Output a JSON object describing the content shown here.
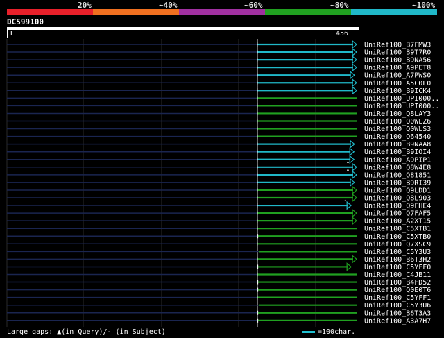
{
  "identity_legend": {
    "labels": [
      "20%",
      "~40%",
      "~60%",
      "~80%",
      "~100%"
    ],
    "colors": [
      "#e8202a",
      "#f07020",
      "#a030a0",
      "#20a020",
      "#20b8c8"
    ]
  },
  "query": {
    "name": "DC599100",
    "start": "1",
    "end": "456"
  },
  "hits": [
    {
      "name": "UniRef100_B7FMW3",
      "color": "#20b8c8",
      "start": 0,
      "end": 456,
      "arrow": true
    },
    {
      "name": "UniRef100_B9T7R0",
      "color": "#20b8c8",
      "start": 0,
      "end": 456,
      "arrow": true
    },
    {
      "name": "UniRef100_B9NA56",
      "color": "#20b8c8",
      "start": 0,
      "end": 456,
      "arrow": true
    },
    {
      "name": "UniRef100_A9PET8",
      "color": "#20b8c8",
      "start": 0,
      "end": 456,
      "arrow": true
    },
    {
      "name": "UniRef100_A7PWS0",
      "color": "#20b8c8",
      "start": 0,
      "end": 446,
      "arrow": true
    },
    {
      "name": "UniRef100_A5C0L0",
      "color": "#20b8c8",
      "start": 0,
      "end": 456,
      "arrow": true
    },
    {
      "name": "UniRef100_B9ICK4",
      "color": "#20b8c8",
      "start": 0,
      "end": 456,
      "arrow": true
    },
    {
      "name": "UniRef100_UPI000..",
      "color": "#20a020",
      "start": 0,
      "end": 456,
      "arrow": false
    },
    {
      "name": "UniRef100_UPI000..",
      "color": "#20a020",
      "start": 0,
      "end": 456,
      "arrow": false
    },
    {
      "name": "UniRef100_Q8LAY3",
      "color": "#20a020",
      "start": 0,
      "end": 456,
      "arrow": false
    },
    {
      "name": "UniRef100_Q0WLZ6",
      "color": "#20a020",
      "start": 0,
      "end": 456,
      "arrow": false
    },
    {
      "name": "UniRef100_Q0WLS3",
      "color": "#20a020",
      "start": 0,
      "end": 456,
      "arrow": false
    },
    {
      "name": "UniRef100_O64540",
      "color": "#20a020",
      "start": 0,
      "end": 456,
      "arrow": false
    },
    {
      "name": "UniRef100_B9NAA8",
      "color": "#20b8c8",
      "start": 0,
      "end": 446,
      "arrow": true
    },
    {
      "name": "UniRef100_B9IOI4",
      "color": "#20b8c8",
      "start": 0,
      "end": 444,
      "arrow": true
    },
    {
      "name": "UniRef100_A9PIP1",
      "color": "#20b8c8",
      "start": 0,
      "end": 444,
      "arrow": true
    },
    {
      "name": "UniRef100_Q8W4E8",
      "color": "#20b8c8",
      "start": 0,
      "end": 456,
      "arrow": true,
      "gap": 416
    },
    {
      "name": "UniRef100_O81851",
      "color": "#20b8c8",
      "start": 0,
      "end": 456,
      "arrow": true,
      "gap": 416
    },
    {
      "name": "UniRef100_B9RI39",
      "color": "#20b8c8",
      "start": 0,
      "end": 446,
      "arrow": true
    },
    {
      "name": "UniRef100_Q9LDD1",
      "color": "#20a020",
      "start": 0,
      "end": 456,
      "arrow": true
    },
    {
      "name": "UniRef100_Q8L903",
      "color": "#20a020",
      "start": 0,
      "end": 456,
      "arrow": true
    },
    {
      "name": "UniRef100_Q9FHE4",
      "color": "#20b8c8",
      "start": 0,
      "end": 431,
      "arrow": true,
      "gap": 404
    },
    {
      "name": "UniRef100_Q7FAF5",
      "color": "#20a020",
      "start": 0,
      "end": 456,
      "arrow": true
    },
    {
      "name": "UniRef100_A2XT15",
      "color": "#20a020",
      "start": 0,
      "end": 456,
      "arrow": true
    },
    {
      "name": "UniRef100_C5XTB1",
      "color": "#20a020",
      "start": 0,
      "end": 456,
      "arrow": false
    },
    {
      "name": "UniRef100_C5XTB0",
      "color": "#20a020",
      "start": 2,
      "end": 456,
      "arrow": false
    },
    {
      "name": "UniRef100_Q7XSC9",
      "color": "#20a020",
      "start": 0,
      "end": 456,
      "arrow": false
    },
    {
      "name": "UniRef100_C5Y3U3",
      "color": "#20a020",
      "start": 8,
      "end": 456,
      "arrow": false
    },
    {
      "name": "UniRef100_B6T3H2",
      "color": "#20a020",
      "start": 0,
      "end": 456,
      "arrow": true
    },
    {
      "name": "UniRef100_C5YFF0",
      "color": "#20a020",
      "start": 2,
      "end": 431,
      "arrow": true
    },
    {
      "name": "UniRef100_C4JB11",
      "color": "#20a020",
      "start": 0,
      "end": 456,
      "arrow": false
    },
    {
      "name": "UniRef100_B4FD52",
      "color": "#20a020",
      "start": 2,
      "end": 456,
      "arrow": false
    },
    {
      "name": "UniRef100_Q0E0T6",
      "color": "#20a020",
      "start": 2,
      "end": 456,
      "arrow": false
    },
    {
      "name": "UniRef100_C5YFF1",
      "color": "#20a020",
      "start": 0,
      "end": 456,
      "arrow": false
    },
    {
      "name": "UniRef100_C5Y3U6",
      "color": "#20a020",
      "start": 8,
      "end": 456,
      "arrow": false
    },
    {
      "name": "UniRef100_B6T3A3",
      "color": "#20a020",
      "start": 2,
      "end": 456,
      "arrow": false
    },
    {
      "name": "UniRef100_A3A7H7",
      "color": "#20a020",
      "start": 2,
      "end": 456,
      "arrow": false
    }
  ],
  "footer": {
    "gaps_text": "Large gaps: ▲(in Query)/- (in Subject)",
    "scale_text": "=100char."
  }
}
